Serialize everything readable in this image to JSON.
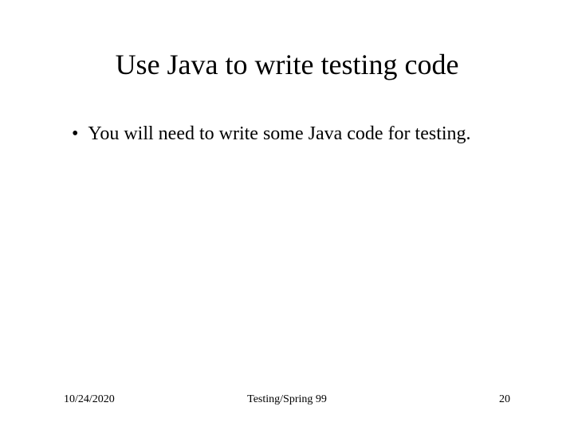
{
  "slide": {
    "title": "Use Java to write testing code",
    "bullets": [
      {
        "text": "You will need to write some Java code for testing."
      }
    ]
  },
  "footer": {
    "date": "10/24/2020",
    "center": "Testing/Spring 99",
    "page": "20"
  }
}
